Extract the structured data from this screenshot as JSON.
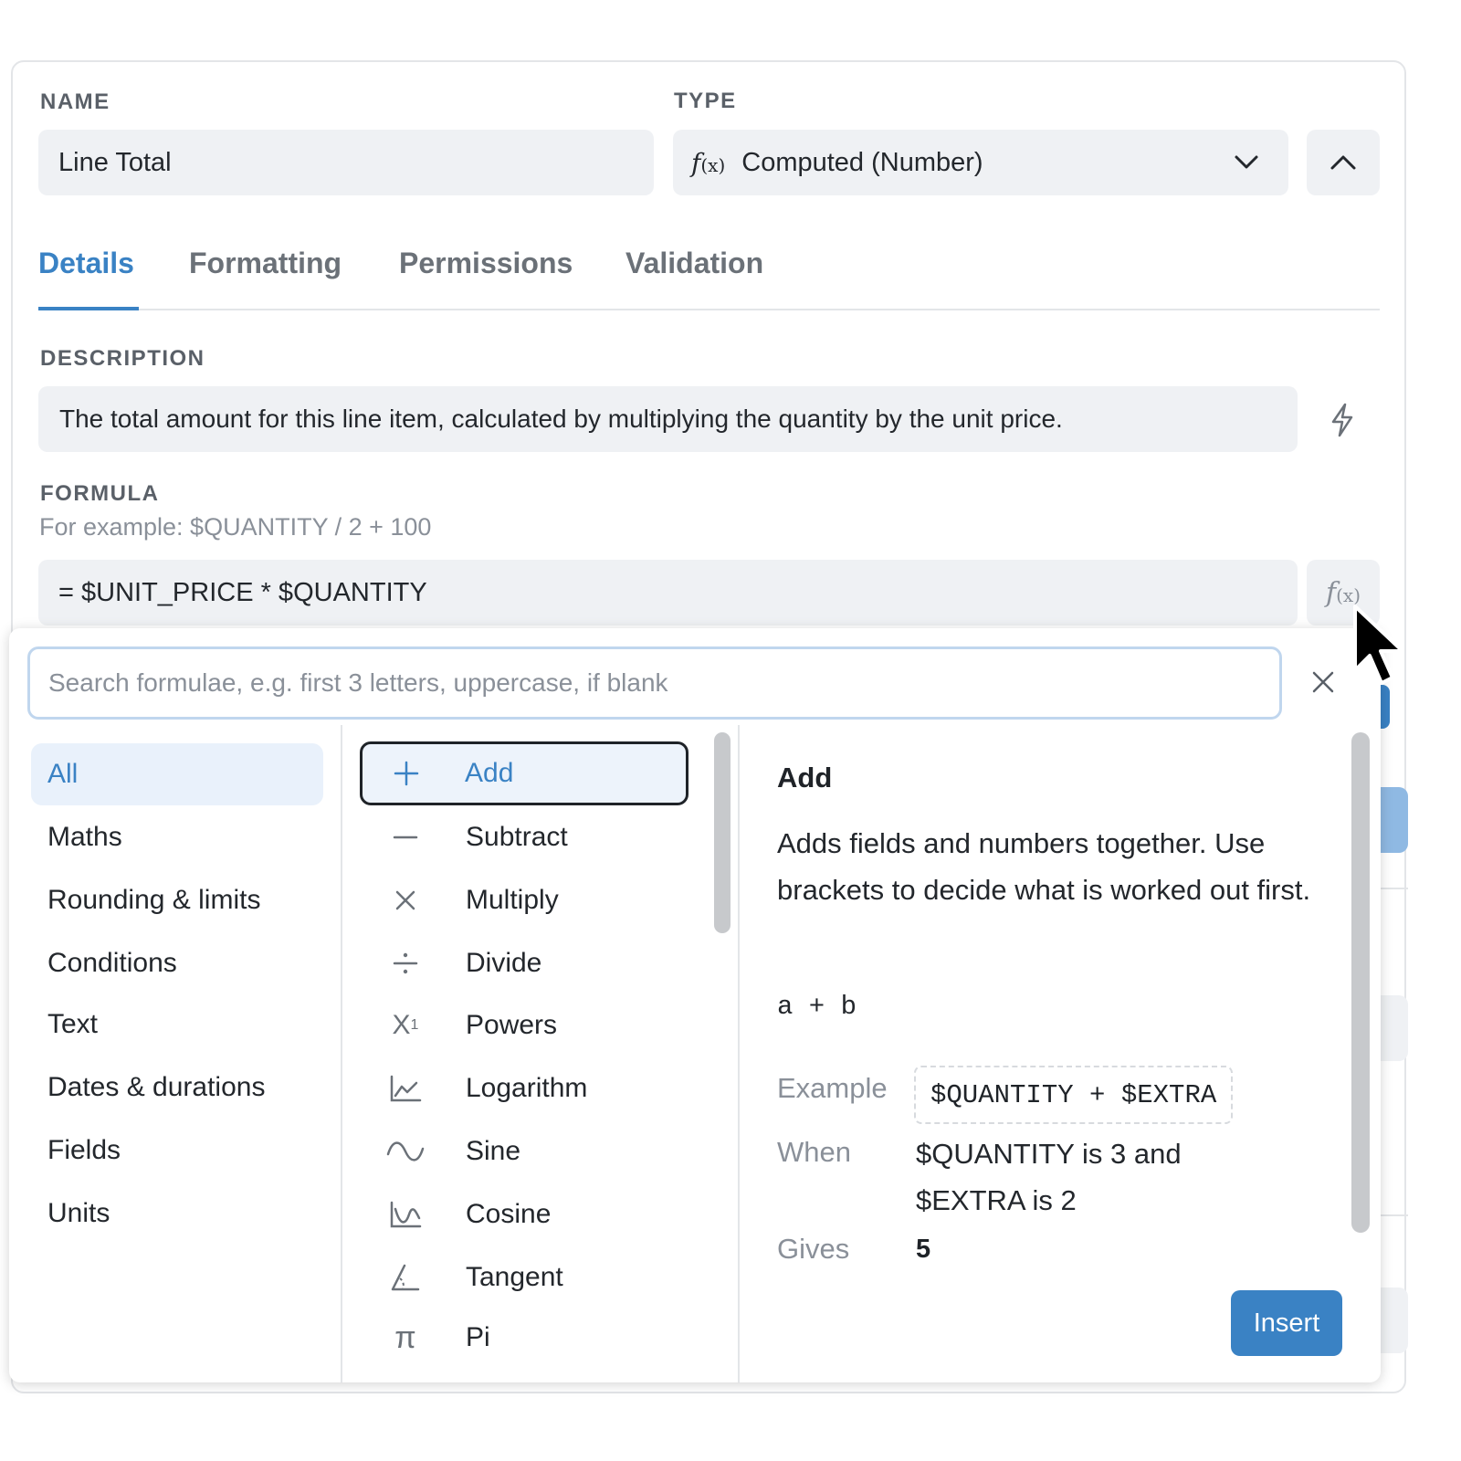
{
  "header": {
    "name_label": "NAME",
    "name_value": "Line Total",
    "type_label": "TYPE",
    "type_icon_glyph": "f",
    "type_icon_suffix": "(x)",
    "type_value": "Computed (Number)"
  },
  "tabs": [
    {
      "label": "Details",
      "active": true
    },
    {
      "label": "Formatting",
      "active": false
    },
    {
      "label": "Permissions",
      "active": false
    },
    {
      "label": "Validation",
      "active": false
    }
  ],
  "description": {
    "label": "DESCRIPTION",
    "value": "The total amount for this line item, calculated by multiplying the quantity by the unit price."
  },
  "formula": {
    "label": "FORMULA",
    "hint": "For example: $QUANTITY / 2 + 100",
    "value": "= $UNIT_PRICE * $QUANTITY",
    "fx_glyph": "f",
    "fx_suffix": "(x)"
  },
  "picker": {
    "search_placeholder": "Search formulae, e.g. first 3 letters, uppercase, if blank",
    "categories": [
      {
        "label": "All",
        "active": true
      },
      {
        "label": "Maths"
      },
      {
        "label": "Rounding & limits"
      },
      {
        "label": "Conditions"
      },
      {
        "label": "Text"
      },
      {
        "label": "Dates & durations"
      },
      {
        "label": "Fields"
      },
      {
        "label": "Units"
      }
    ],
    "functions": [
      {
        "label": "Add",
        "icon": "plus-icon",
        "active": true
      },
      {
        "label": "Subtract",
        "icon": "minus-icon"
      },
      {
        "label": "Multiply",
        "icon": "multiply-icon"
      },
      {
        "label": "Divide",
        "icon": "divide-icon"
      },
      {
        "label": "Powers",
        "icon": "powers-icon",
        "glyph": "X",
        "sup": "1"
      },
      {
        "label": "Logarithm",
        "icon": "logarithm-icon"
      },
      {
        "label": "Sine",
        "icon": "sine-icon"
      },
      {
        "label": "Cosine",
        "icon": "cosine-icon"
      },
      {
        "label": "Tangent",
        "icon": "tangent-icon"
      },
      {
        "label": "Pi",
        "icon": "pi-icon",
        "glyph": "π"
      }
    ],
    "detail": {
      "title": "Add",
      "description": "Adds fields and numbers together. Use brackets to decide what is worked out first.",
      "syntax": "a + b",
      "example_label": "Example",
      "example_code": "$QUANTITY + $EXTRA",
      "when_label": "When",
      "when_value": "$QUANTITY is 3 and $EXTRA is 2",
      "gives_label": "Gives",
      "gives_value": "5",
      "insert_label": "Insert"
    }
  },
  "colors": {
    "accent": "#3a82c4",
    "field_bg": "#eff1f4",
    "border": "#e3e5e8"
  }
}
